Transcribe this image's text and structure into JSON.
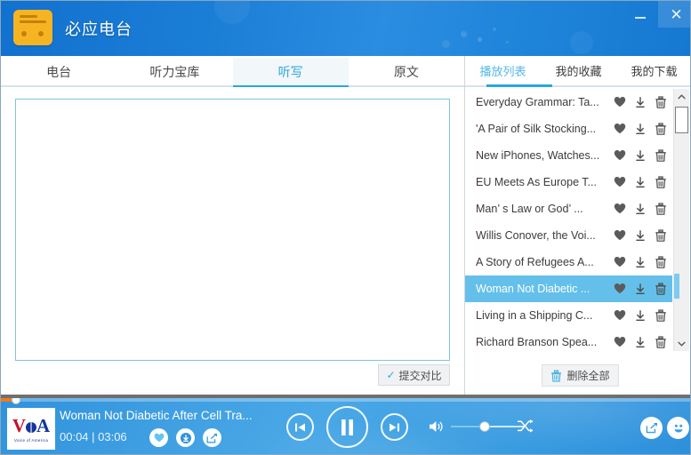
{
  "window": {
    "app_title": "必应电台",
    "logo_icon": "radio-icon",
    "minimize_label": "—",
    "close_label": "✕"
  },
  "left_panel": {
    "tabs": [
      {
        "label": "电台",
        "active": false
      },
      {
        "label": "听力宝库",
        "active": false
      },
      {
        "label": "听写",
        "active": true
      },
      {
        "label": "原文",
        "active": false
      }
    ],
    "dictation_input": {
      "value": "",
      "placeholder": ""
    },
    "submit_button": {
      "label": "提交对比",
      "icon": "check-icon",
      "icon_glyph": "✓"
    }
  },
  "right_panel": {
    "tabs": [
      {
        "label": "播放列表",
        "active": true
      },
      {
        "label": "我的收藏",
        "active": false
      },
      {
        "label": "我的下载",
        "active": false
      }
    ],
    "playlist": [
      {
        "title": "Everyday Grammar: Ta...",
        "selected": false
      },
      {
        "title": "'A Pair of Silk Stocking...",
        "selected": false
      },
      {
        "title": "New iPhones, Watches...",
        "selected": false
      },
      {
        "title": "EU Meets As Europe T...",
        "selected": false
      },
      {
        "title": "Man’ s Law or God’ ...",
        "selected": false
      },
      {
        "title": "Willis Conover, the Voi...",
        "selected": false
      },
      {
        "title": "A Story of Refugees A...",
        "selected": false
      },
      {
        "title": "Woman Not Diabetic ...",
        "selected": true
      },
      {
        "title": "Living in a Shipping C...",
        "selected": false
      },
      {
        "title": "Richard Branson Spea...",
        "selected": false
      }
    ],
    "row_icons": {
      "favorite": "heart-icon",
      "download": "download-icon",
      "delete": "trash-icon"
    },
    "delete_all_button": {
      "label": "删除全部",
      "icon": "trash-icon"
    },
    "scrollbar": {
      "up_arrow": "▲",
      "down_arrow": "▼"
    }
  },
  "player": {
    "station_logo": {
      "mark_left": "V",
      "mark_right": "A",
      "caption": "Voice of America"
    },
    "now_playing_title": "Woman Not Diabetic After Cell Tra...",
    "elapsed": "00:04",
    "time_separator": "|",
    "duration": "03:06",
    "time_display": "00:04 | 03:06",
    "progress_percent": 2,
    "volume_percent": 52,
    "controls": {
      "previous": "previous-icon",
      "play_pause": "pause-icon",
      "next": "next-icon",
      "volume": "volume-icon",
      "shuffle": "shuffle-icon",
      "favorite": "heart-icon",
      "download": "download-icon",
      "share": "share-icon",
      "share_right": "share-icon",
      "feedback": "smiley-icon"
    }
  },
  "colors": {
    "header_blue": "#1b7ed6",
    "player_blue": "#3f9fe2",
    "accent_cyan": "#2aa6e0",
    "selected_row": "#64c0ea",
    "progress_orange": "#ef7b19",
    "logo_yellow": "#f7b422",
    "voa_red": "#c8102e",
    "voa_blue": "#12359a"
  }
}
